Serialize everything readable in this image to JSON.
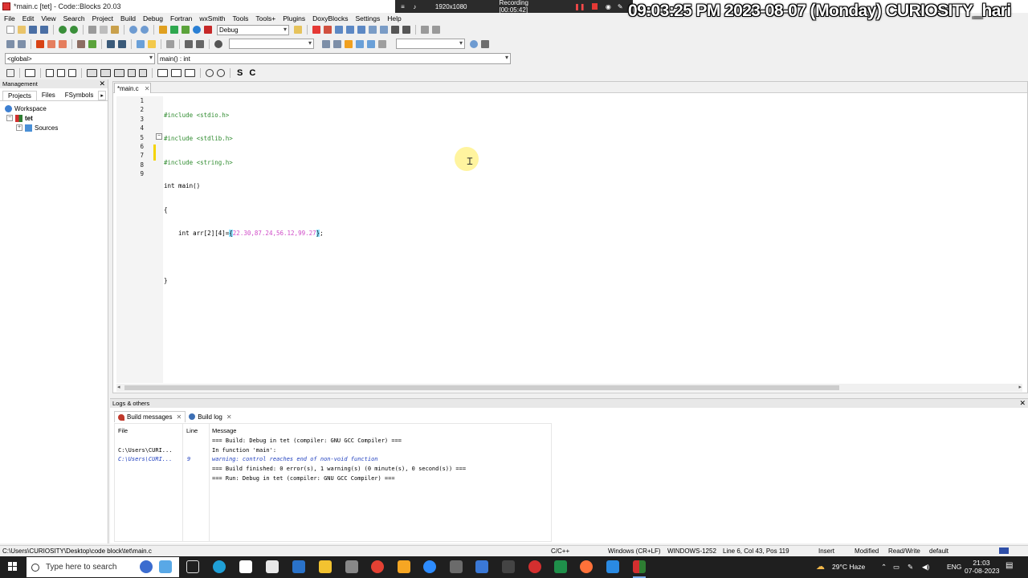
{
  "window": {
    "title": "*main.c [tet] - Code::Blocks 20.03"
  },
  "recorder": {
    "resolution": "1920x1080",
    "status": "Recording [00:05:42]"
  },
  "overlay": {
    "clock": "09:03:25 PM  2023-08-07 (Monday) CURIOSITY_hari"
  },
  "menu": [
    "File",
    "Edit",
    "View",
    "Search",
    "Project",
    "Build",
    "Debug",
    "Fortran",
    "wxSmith",
    "Tools",
    "Tools+",
    "Plugins",
    "DoxyBlocks",
    "Settings",
    "Help"
  ],
  "toolbar": {
    "build_target": "Debug",
    "scope": "<global>",
    "function": "main() : int"
  },
  "management": {
    "title": "Management",
    "tabs": [
      "Projects",
      "Files",
      "FSymbols"
    ],
    "tree": {
      "workspace": "Workspace",
      "project": "tet",
      "folder": "Sources"
    }
  },
  "editor": {
    "tab": "*main.c",
    "line_numbers": [
      "1",
      "2",
      "3",
      "4",
      "5",
      "6",
      "7",
      "8",
      "9"
    ],
    "lines": {
      "l1": "#include <stdio.h>",
      "l2": "#include <stdlib.h>",
      "l3": "#include <string.h>",
      "l4": "int main()",
      "l5": "{",
      "l6a": "    int arr[2][4]=",
      "l6b": "{",
      "l6c": "22.30,87.24,56.12,99.27",
      "l6d": "}",
      "l6e": ";",
      "l7": "",
      "l8": "}",
      "l9": ""
    }
  },
  "logs": {
    "title": "Logs & others",
    "tabs": [
      "Build messages",
      "Build log"
    ],
    "columns": [
      "File",
      "Line",
      "Message"
    ],
    "rows": [
      {
        "file": "",
        "line": "",
        "message": "=== Build: Debug in tet (compiler: GNU GCC Compiler) ===",
        "kind": "normal"
      },
      {
        "file": "C:\\Users\\CURI...",
        "line": "",
        "message": "In function 'main':",
        "kind": "normal"
      },
      {
        "file": "C:\\Users\\CURI...",
        "line": "9",
        "message": "warning: control reaches end of non-void function",
        "kind": "warning"
      },
      {
        "file": "",
        "line": "",
        "message": "=== Build finished: 0 error(s), 1 warning(s) (0 minute(s), 0 second(s)) ===",
        "kind": "normal"
      },
      {
        "file": "",
        "line": "",
        "message": "=== Run: Debug in tet (compiler: GNU GCC Compiler) ===",
        "kind": "normal"
      }
    ]
  },
  "status": {
    "path": "C:\\Users\\CURIOSITY\\Desktop\\code block\\tet\\main.c",
    "language": "C/C++",
    "eol": "Windows (CR+LF)",
    "encoding": "WINDOWS-1252",
    "position": "Line 6, Col 43, Pos 119",
    "mode": "Insert",
    "modified": "Modified",
    "access": "Read/Write",
    "profile": "default"
  },
  "taskbar": {
    "search_placeholder": "Type here to search",
    "weather": "29°C  Haze",
    "lang": "ENG",
    "time": "21:03",
    "date": "07-08-2023"
  },
  "colors": {
    "accent": "#2e8b2e",
    "number": "#d04cc8",
    "warning": "#1f3fbf",
    "taskbar": "#1f1f1f"
  }
}
